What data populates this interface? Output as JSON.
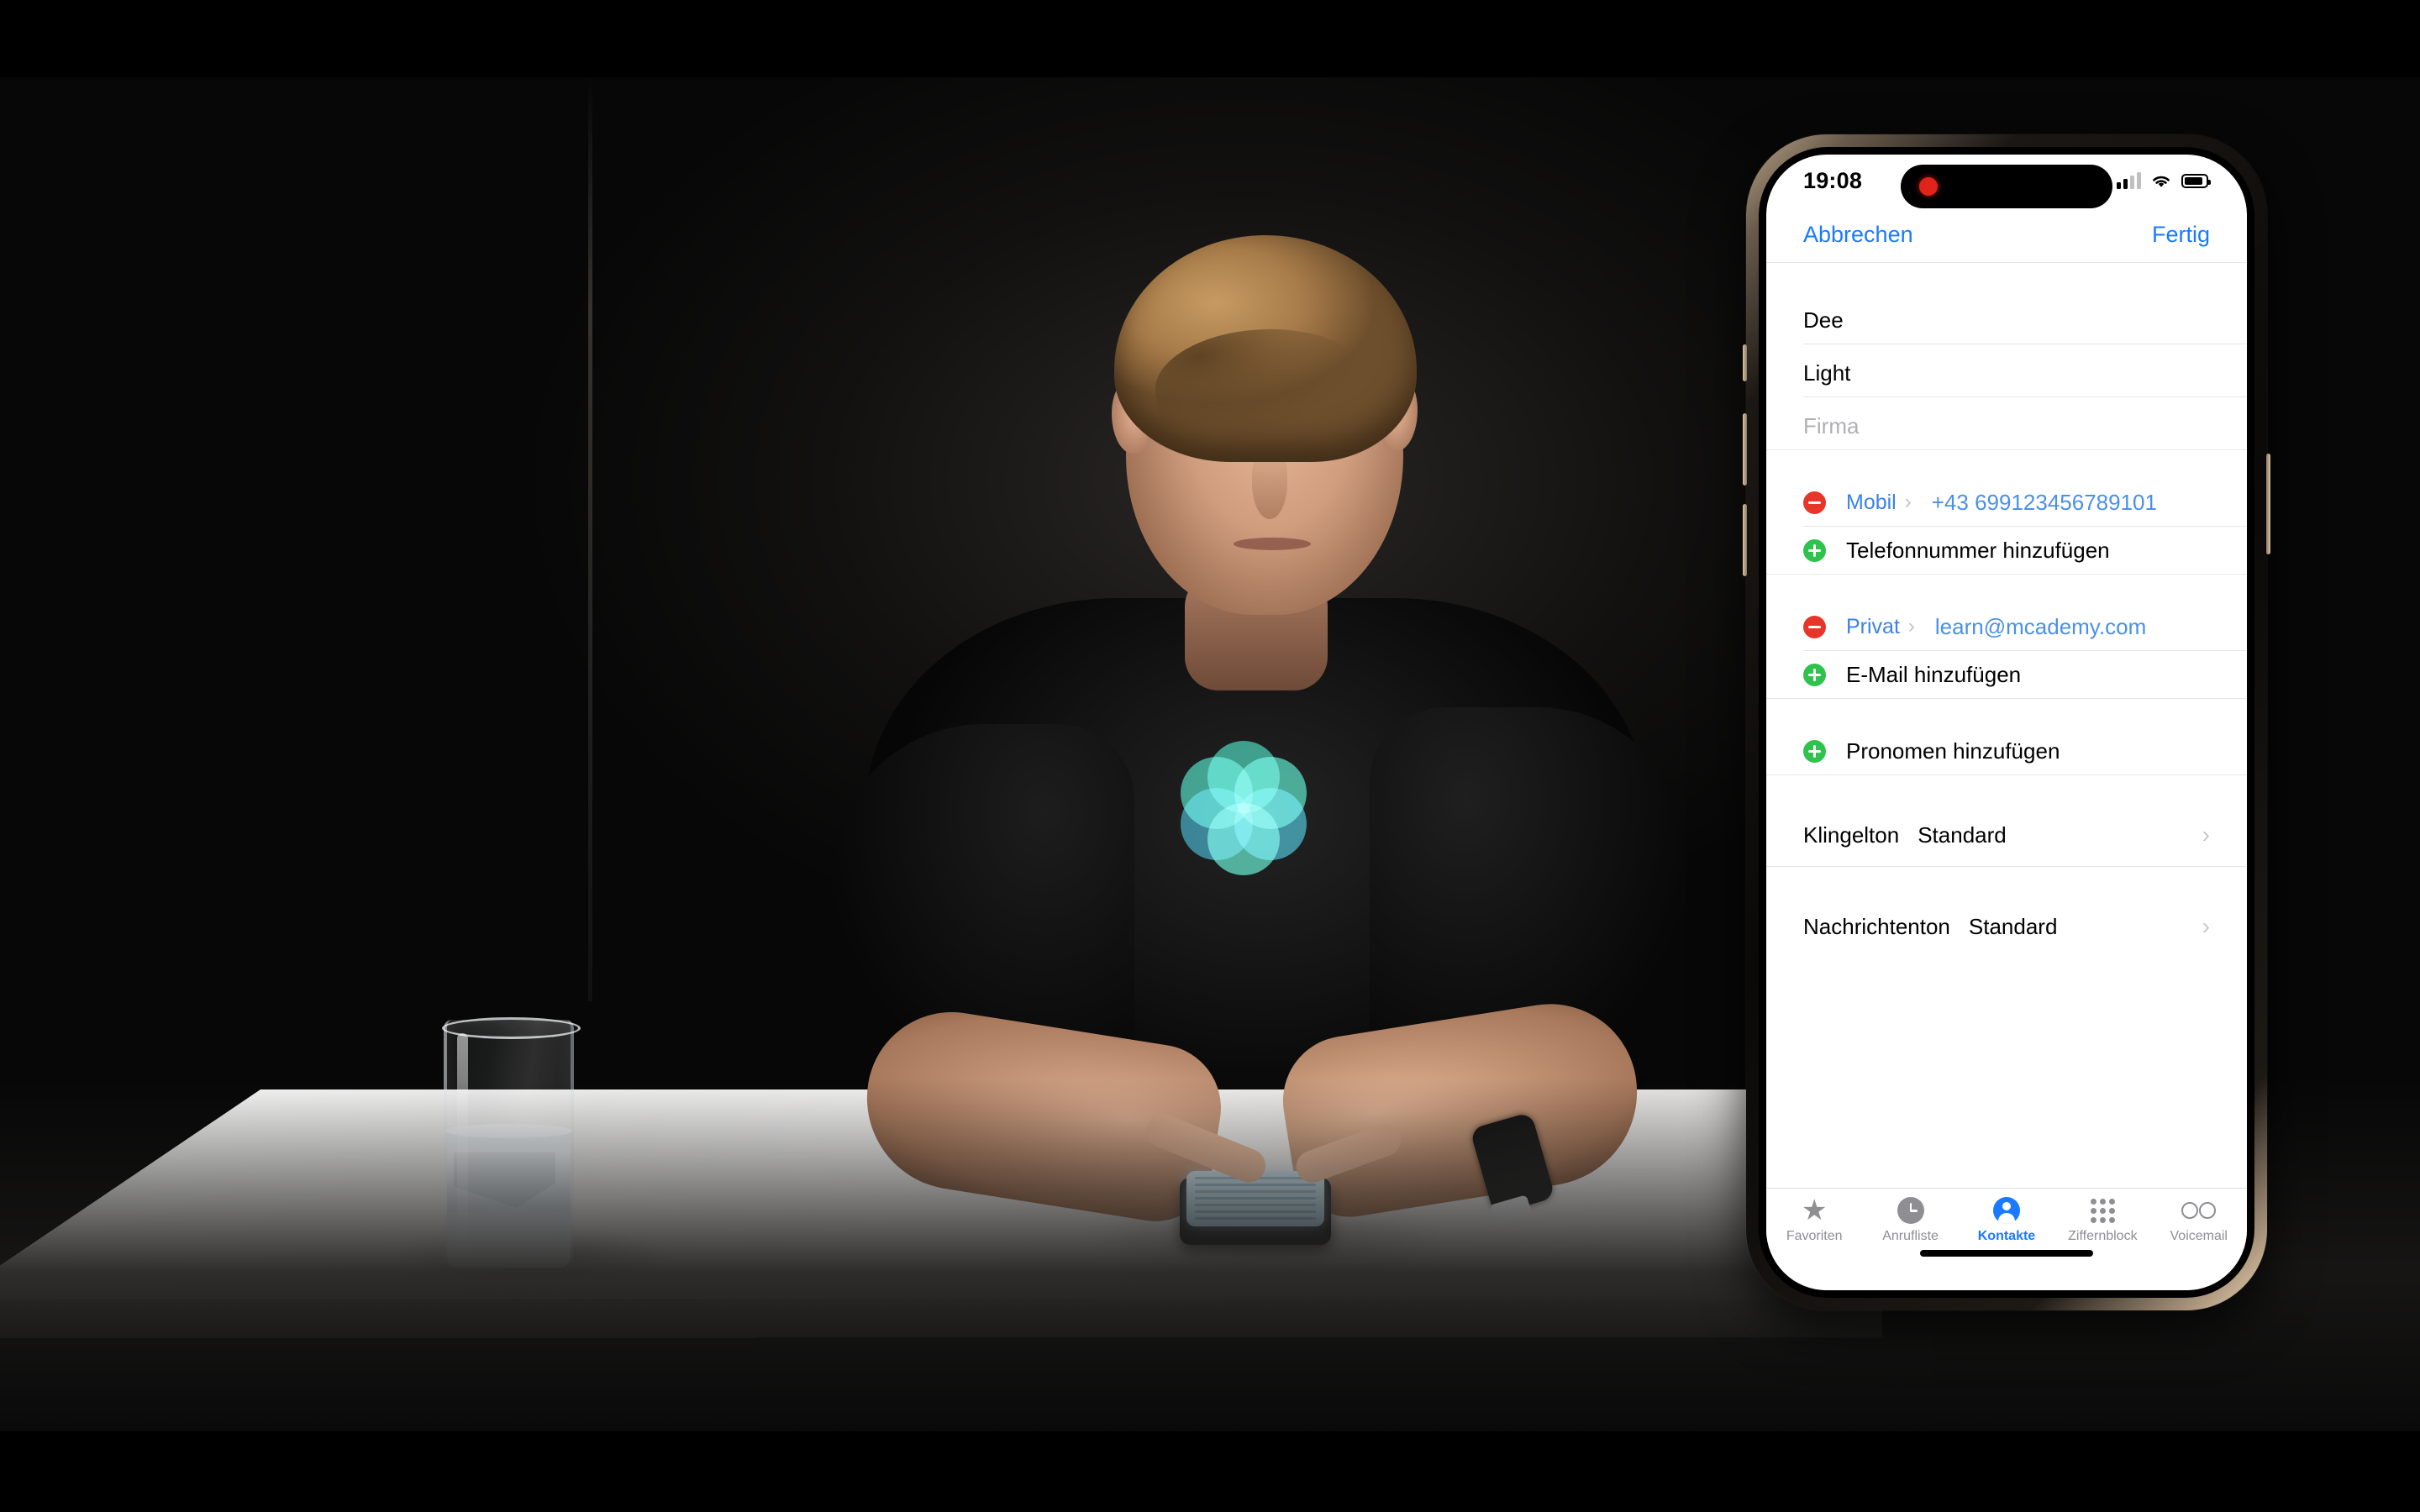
{
  "scene": {
    "description_objects": [
      "presenter",
      "water-glass",
      "white-table",
      "handheld-phone",
      "wristwatch"
    ],
    "shirt_logo": "flower-of-life-logo",
    "logo_colors": [
      "#2fb39a",
      "#3fc3a8",
      "#2f9fb3",
      "#48c9b0",
      "#2a8fa8",
      "#35b8a0"
    ]
  },
  "phone": {
    "status_bar": {
      "time": "19:08",
      "recording_indicator": "record-dot",
      "cellular_icon": "cellular-signal-icon",
      "wifi_icon": "wifi-icon",
      "battery_icon": "battery-icon"
    },
    "nav": {
      "cancel_label": "Abbrechen",
      "done_label": "Fertig"
    },
    "name_fields": [
      {
        "value": "Dee",
        "is_placeholder": false
      },
      {
        "value": "Light",
        "is_placeholder": false
      },
      {
        "value": "Firma",
        "is_placeholder": true
      }
    ],
    "phone_section": {
      "entry": {
        "remove_icon": "minus-circle-icon",
        "label": "Mobil",
        "disclosure": "chevron-right-icon",
        "value": "+43 699123456789101"
      },
      "add": {
        "add_icon": "plus-circle-icon",
        "label": "Telefonnummer hinzufügen"
      }
    },
    "email_section": {
      "entry": {
        "remove_icon": "minus-circle-icon",
        "label": "Privat",
        "disclosure": "chevron-right-icon",
        "value": "learn@mcademy.com"
      },
      "add": {
        "add_icon": "plus-circle-icon",
        "label": "E-Mail hinzufügen"
      }
    },
    "pronoun_section": {
      "add_icon": "plus-circle-icon",
      "label": "Pronomen hinzufügen"
    },
    "settings_rows": [
      {
        "key": "Klingelton",
        "value": "Standard",
        "chevron": "›"
      },
      {
        "key": "Nachrichtenton",
        "value": "Standard",
        "chevron": "›"
      }
    ],
    "tabbar": [
      {
        "label": "Favoriten",
        "icon": "star-icon",
        "active": false
      },
      {
        "label": "Anrufliste",
        "icon": "clock-icon",
        "active": false
      },
      {
        "label": "Kontakte",
        "icon": "person-icon",
        "active": true
      },
      {
        "label": "Ziffernblock",
        "icon": "keypad-icon",
        "active": false
      },
      {
        "label": "Voicemail",
        "icon": "voicemail-icon",
        "active": false
      }
    ],
    "colors": {
      "accent_blue": "#1a7aff",
      "value_blue": "#4a90e8",
      "remove_red": "#e8352a",
      "add_green": "#2fc24d",
      "inactive_gray": "#8e8e93"
    }
  }
}
